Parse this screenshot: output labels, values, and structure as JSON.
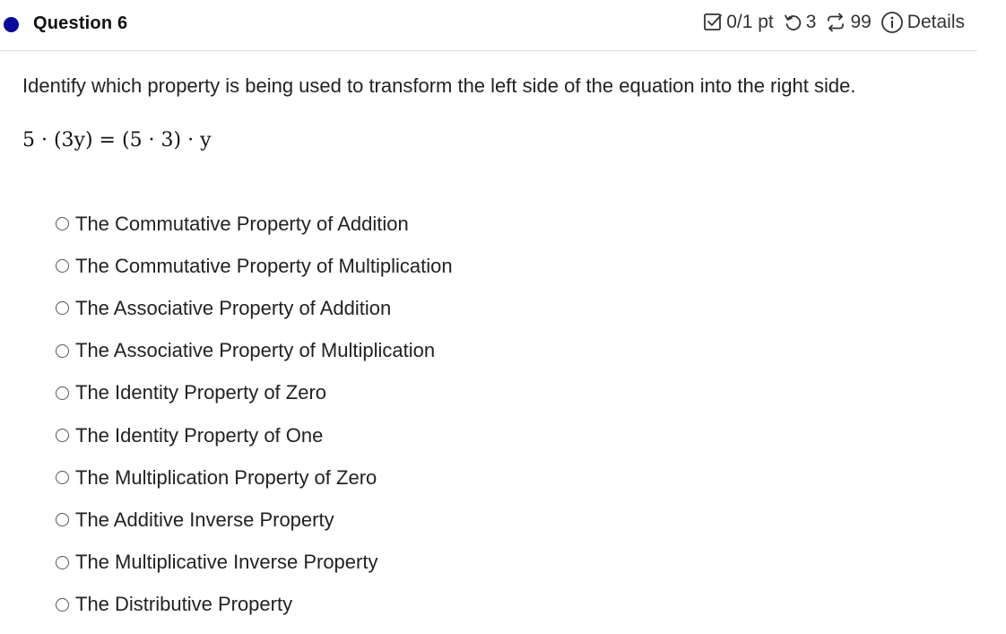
{
  "header": {
    "title": "Question 6",
    "score": "0/1 pt",
    "attempts": "3",
    "submissions": "99",
    "details_label": "Details",
    "icons": {
      "score": "checkbox-icon",
      "attempts": "retry-icon",
      "submissions": "refresh-icon",
      "details": "info-icon"
    },
    "colors": {
      "question_dot": "#0a0a9c"
    }
  },
  "question": {
    "prompt": "Identify which property is being used to transform the left side of the equation into the right side.",
    "equation": "5 · (3y) = (5 · 3) · y"
  },
  "options": [
    "The Commutative Property of Addition",
    "The Commutative Property of Multiplication",
    "The Associative Property of Addition",
    "The Associative Property of Multiplication",
    "The Identity Property of Zero",
    "The Identity Property of One",
    "The Multiplication Property of Zero",
    "The Additive Inverse Property",
    "The Multiplicative Inverse Property",
    "The Distributive Property"
  ]
}
